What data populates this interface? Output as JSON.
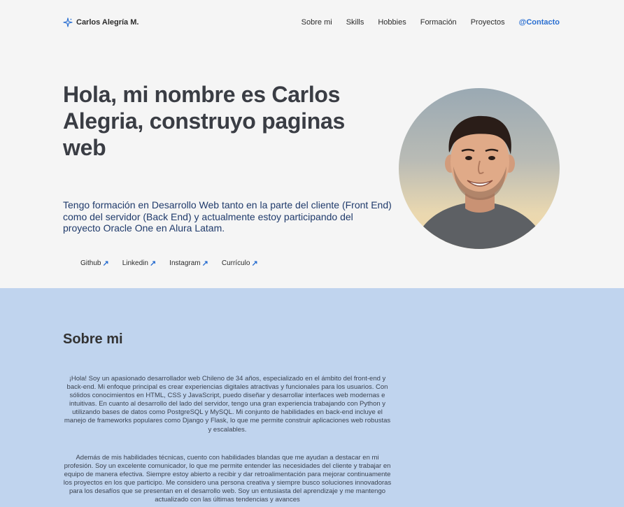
{
  "nav": {
    "brand": "Carlos Alegría M.",
    "brand_icon": "sparkle-icon",
    "items": [
      "Sobre mi",
      "Skills",
      "Hobbies",
      "Formación",
      "Proyectos"
    ],
    "contact": "@Contacto",
    "accent": "#2a6fd1"
  },
  "hero": {
    "title": "Hola, mi nombre es Carlos Alegria, construyo paginas web",
    "description": "Tengo formación en Desarrollo Web tanto en la parte del cliente (Front End) como del servidor (Back End) y actualmente estoy participando del proyecto Oracle One en Alura Latam.",
    "links": [
      "Github",
      "Linkedin",
      "Instagram",
      "Currículo"
    ],
    "link_icon": "arrow-up-right-icon"
  },
  "about": {
    "title": "Sobre mi",
    "paragraph1": "¡Hola! Soy un apasionado desarrollador web Chileno de 34 años, especializado en el ámbito del front-end y back-end. Mi enfoque principal es crear experiencias digitales atractivas y funcionales para los usuarios. Con sólidos conocimientos en HTML, CSS y JavaScript, puedo diseñar y desarrollar interfaces web modernas e intuitivas. En cuanto al desarrollo del lado del servidor, tengo una gran experiencia trabajando con Python y utilizando bases de datos como PostgreSQL y MySQL. Mi conjunto de habilidades en back-end incluye el manejo de frameworks populares como Django y Flask, lo que me permite construir aplicaciones web robustas y escalables.",
    "paragraph2": "Además de mis habilidades técnicas, cuento con habilidades blandas que me ayudan a destacar en mi profesión. Soy un excelente comunicador, lo que me permite entender las necesidades del cliente y trabajar en equipo de manera efectiva. Siempre estoy abierto a recibir y dar retroalimentación para mejorar continuamente los proyectos en los que participo. Me considero una persona creativa y siempre busco soluciones innovadoras para los desafíos que se presentan en el desarrollo web. Soy un entusiasta del aprendizaje y me mantengo actualizado con las últimas tendencias y avances"
  }
}
